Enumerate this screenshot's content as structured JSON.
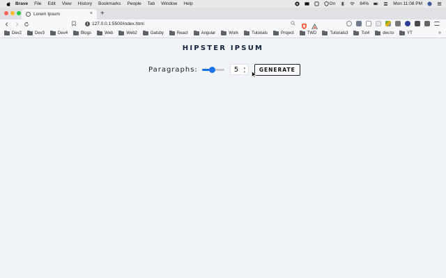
{
  "menubar": {
    "app_name": "Brave",
    "items": [
      "File",
      "Edit",
      "View",
      "History",
      "Bookmarks",
      "People",
      "Tab",
      "Window",
      "Help"
    ],
    "status_on": "On",
    "battery": "84%",
    "clock": "Mon 11:08 PM"
  },
  "tab": {
    "title": "Lorem Ipsum",
    "close": "×",
    "new_tab": "+"
  },
  "address": {
    "url": "127.0.0.1:5500/index.html"
  },
  "bookmarks": [
    "Dev2",
    "Dev3",
    "Dev4",
    "Blogs",
    "Web",
    "Web2",
    "Gatsby",
    "React",
    "Angular",
    "Work",
    "Tutorials",
    "Project",
    "TWD",
    "Tutorials3",
    "Tut4",
    "dev.to",
    "YT"
  ],
  "page": {
    "title": "HIPSTER IPSUM",
    "paragraphs_label": "Paragraphs:",
    "paragraphs_value": "5",
    "slider_fraction": 0.45,
    "generate_label": "GENERATE"
  },
  "colors": {
    "accent": "#1a73e8",
    "page_bg": "#f0f3f7",
    "title": "#11223d"
  }
}
